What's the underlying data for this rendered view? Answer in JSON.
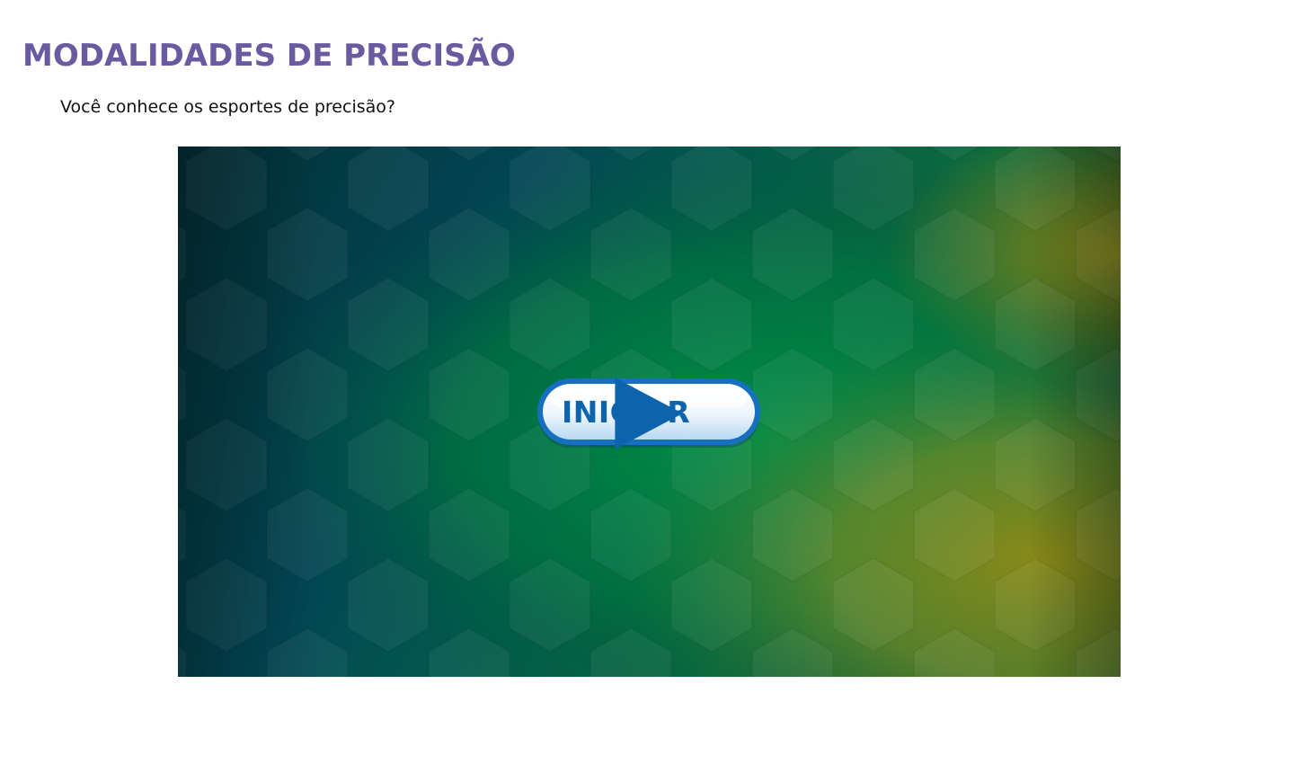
{
  "header": {
    "title": "MODALIDADES DE PRECISÃO",
    "subtitle": "Você conhece os esportes de precisão?"
  },
  "activity": {
    "start_button_label": "INICIAR",
    "start_button_icon": "play-arrow-icon",
    "background_pattern": "hexagon-pattern"
  },
  "colors": {
    "title": "#6a5aa0",
    "button_text": "#0e63ad",
    "button_border": "#1670bf",
    "bg_dark": "#04262b",
    "bg_teal": "#024a55",
    "bg_green": "#008a45",
    "bg_olive": "#8a8a20"
  }
}
